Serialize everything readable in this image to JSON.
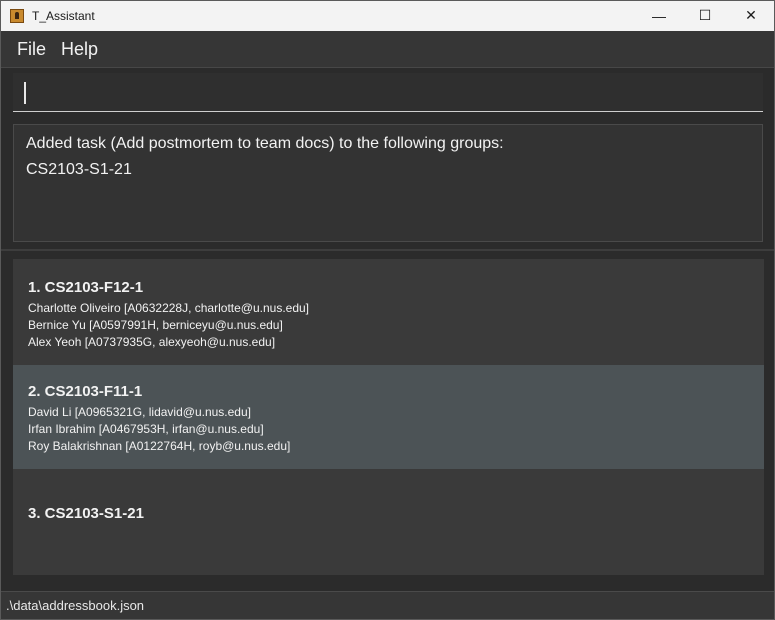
{
  "window": {
    "title": "T_Assistant",
    "controls": {
      "minimize": "—",
      "maximize": "☐",
      "close": "✕"
    }
  },
  "menubar": {
    "file": "File",
    "help": "Help"
  },
  "command": {
    "value": "",
    "placeholder": ""
  },
  "result": {
    "line1": "Added task (Add postmortem to team docs) to the following groups:",
    "line2": "CS2103-S1-21"
  },
  "groups": [
    {
      "name": "1.  CS2103-F12-1",
      "members": [
        "Charlotte Oliveiro [A0632228J, charlotte@u.nus.edu]",
        "Bernice Yu [A0597991H, berniceyu@u.nus.edu]",
        "Alex Yeoh [A0737935G, alexyeoh@u.nus.edu]"
      ]
    },
    {
      "name": "2.  CS2103-F11-1",
      "members": [
        "David Li [A0965321G, lidavid@u.nus.edu]",
        "Irfan Ibrahim [A0467953H, irfan@u.nus.edu]",
        "Roy Balakrishnan [A0122764H, royb@u.nus.edu]"
      ]
    },
    {
      "name": "3.  CS2103-S1-21",
      "members": []
    }
  ],
  "selected_index": 1,
  "statusbar": {
    "path": ".\\data\\addressbook.json"
  },
  "colors": {
    "background": "#2b2b2b",
    "titlebar": "#f3f3f3",
    "list_panel": "#3a3a3a",
    "selected_card": "#4c5356",
    "text": "#f2f2f2"
  }
}
